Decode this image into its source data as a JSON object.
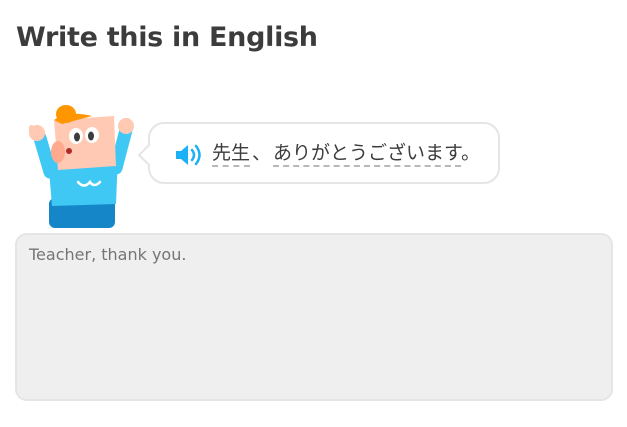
{
  "header": {
    "title": "Write this in English"
  },
  "prompt": {
    "tokens": [
      "先生",
      "、",
      "ありがとうございます",
      "。"
    ],
    "speaker_icon": "speaker-icon",
    "accent_color": "#1cb0f6"
  },
  "answer": {
    "placeholder": "Teacher, thank you."
  },
  "colors": {
    "title": "#3c3c3c",
    "border": "#e5e5e5",
    "input_bg": "#efefef",
    "character_shirt": "#40c8f4",
    "character_hair": "#ff9600"
  }
}
